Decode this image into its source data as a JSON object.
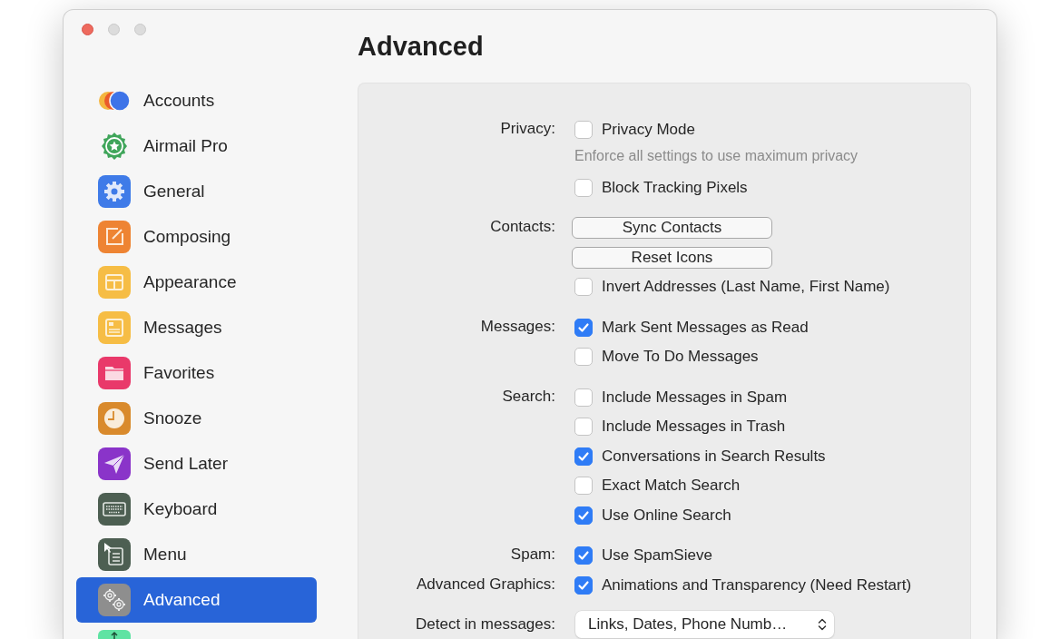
{
  "window": {
    "title": "Advanced"
  },
  "sidebar": {
    "items": [
      {
        "label": "Accounts",
        "selected": false
      },
      {
        "label": "Airmail Pro",
        "selected": false
      },
      {
        "label": "General",
        "selected": false
      },
      {
        "label": "Composing",
        "selected": false
      },
      {
        "label": "Appearance",
        "selected": false
      },
      {
        "label": "Messages",
        "selected": false
      },
      {
        "label": "Favorites",
        "selected": false
      },
      {
        "label": "Snooze",
        "selected": false
      },
      {
        "label": "Send Later",
        "selected": false
      },
      {
        "label": "Keyboard",
        "selected": false
      },
      {
        "label": "Menu",
        "selected": false
      },
      {
        "label": "Advanced",
        "selected": true
      },
      {
        "selected": false
      }
    ]
  },
  "sections": [
    {
      "label": "Privacy:",
      "controls": [
        {
          "kind": "checkbox",
          "label": "Privacy Mode",
          "checked": false
        },
        {
          "kind": "hint",
          "text": "Enforce all settings to use maximum privacy"
        },
        {
          "kind": "checkbox",
          "label": "Block Tracking Pixels",
          "checked": false
        }
      ]
    },
    {
      "label": "Contacts:",
      "controls": [
        {
          "kind": "button",
          "label": "Sync Contacts"
        },
        {
          "kind": "button",
          "label": "Reset Icons"
        },
        {
          "kind": "checkbox",
          "label": "Invert Addresses (Last Name, First Name)",
          "checked": false
        }
      ]
    },
    {
      "label": "Messages:",
      "controls": [
        {
          "kind": "checkbox",
          "label": "Mark Sent Messages as Read",
          "checked": true
        },
        {
          "kind": "checkbox",
          "label": "Move To Do Messages",
          "checked": false
        }
      ]
    },
    {
      "label": "Search:",
      "controls": [
        {
          "kind": "checkbox",
          "label": "Include Messages in Spam",
          "checked": false
        },
        {
          "kind": "checkbox",
          "label": "Include Messages in Trash",
          "checked": false
        },
        {
          "kind": "checkbox",
          "label": "Conversations in Search Results",
          "checked": true
        },
        {
          "kind": "checkbox",
          "label": "Exact Match Search",
          "checked": false
        },
        {
          "kind": "checkbox",
          "label": "Use Online Search",
          "checked": true
        }
      ]
    },
    {
      "label": "Spam:",
      "controls": [
        {
          "kind": "checkbox",
          "label": "Use SpamSieve",
          "checked": true
        }
      ]
    },
    {
      "label": "Advanced Graphics:",
      "controls": [
        {
          "kind": "checkbox",
          "label": "Animations and Transparency (Need Restart)",
          "checked": true
        }
      ]
    },
    {
      "label": "Detect in messages:",
      "controls": [
        {
          "kind": "popup",
          "value": "Links, Dates, Phone Numb…"
        }
      ]
    }
  ]
}
